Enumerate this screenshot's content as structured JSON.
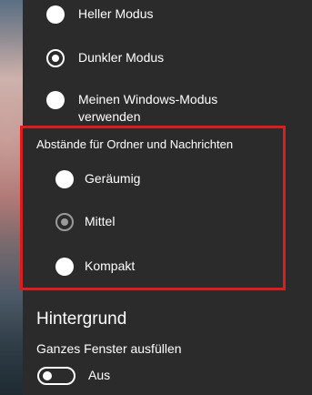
{
  "theme": {
    "options": [
      {
        "label": "Heller Modus",
        "checked": false
      },
      {
        "label": "Dunkler Modus",
        "checked": true
      },
      {
        "label": "Meinen Windows-Modus verwenden",
        "line1": "Meinen Windows-Modus",
        "line2": "verwenden",
        "checked": false
      }
    ]
  },
  "spacing": {
    "title": "Abstände für Ordner und Nachrichten",
    "options": [
      {
        "label": "Geräumig",
        "checked": false
      },
      {
        "label": "Mittel",
        "checked": true
      },
      {
        "label": "Kompakt",
        "checked": false
      }
    ]
  },
  "background": {
    "heading": "Hintergrund",
    "fill_label": "Ganzes Fenster ausfüllen",
    "toggle_state": "Aus",
    "toggle_on": false
  },
  "colors": {
    "panel": "#2b2b2b",
    "highlight": "#e01b1b",
    "text": "#ffffff"
  }
}
